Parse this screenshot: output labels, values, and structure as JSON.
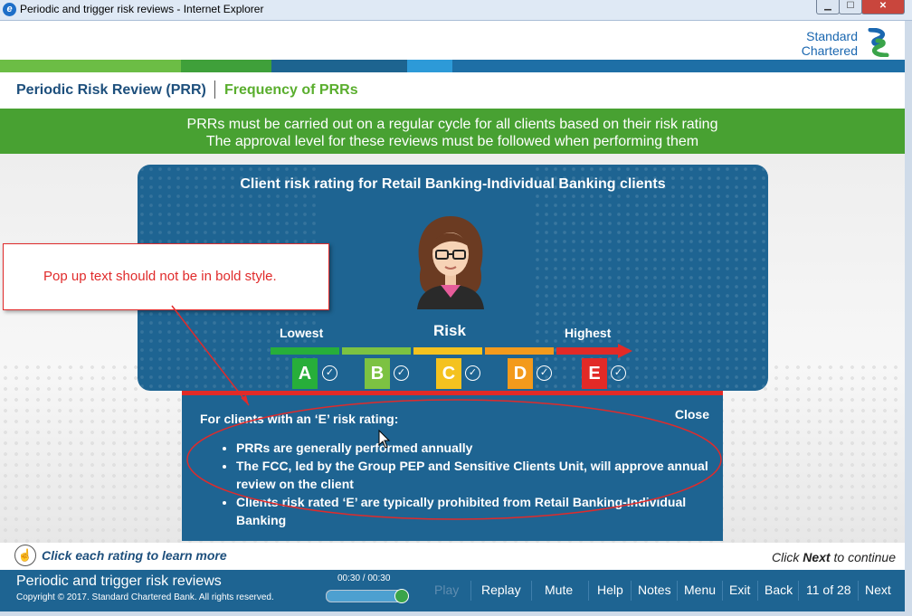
{
  "window": {
    "title": "Periodic and trigger risk reviews - Internet Explorer",
    "minimize": "▁",
    "maximize": "☐",
    "close": "✕"
  },
  "logo": {
    "line1": "Standard",
    "line2": "Chartered"
  },
  "colors": {
    "blue": "#1e6492",
    "green": "#48a132",
    "red": "#e22a27",
    "accent_green": "#5aae2e"
  },
  "breadcrumb": {
    "main": "Periodic Risk Review (PRR)",
    "sub": "Frequency of PRRs"
  },
  "banner": {
    "line1": "PRRs must be carried out on a regular cycle for all clients based on their risk rating",
    "line2": "The approval level for these reviews must be followed when performing them"
  },
  "card": {
    "title": "Client risk rating for Retail Banking-Individual Banking clients",
    "lowest": "Lowest",
    "risk": "Risk",
    "highest": "Highest",
    "ratings": [
      {
        "letter": "A",
        "color": "#27ae3a"
      },
      {
        "letter": "B",
        "color": "#7cc242"
      },
      {
        "letter": "C",
        "color": "#f4c21f"
      },
      {
        "letter": "D",
        "color": "#f39a1c"
      },
      {
        "letter": "E",
        "color": "#e22a27"
      }
    ],
    "check": "✓"
  },
  "popup": {
    "heading": "For clients with an ‘E’ risk rating:",
    "close": "Close",
    "bullets": [
      "PRRs are generally performed annually",
      "The FCC, led by the Group PEP and Sensitive Clients Unit, will approve annual review on the client",
      "Clients risk rated ‘E’ are typically prohibited from Retail Banking-Individual Banking"
    ]
  },
  "annotation": {
    "text": "Pop up text should not be in bold style."
  },
  "hint": {
    "icon": "☝",
    "text": "Click each rating to learn more"
  },
  "next_hint": {
    "pre": "Click ",
    "bold": "Next",
    "post": " to continue"
  },
  "footer": {
    "title": "Periodic and trigger risk reviews",
    "copyright": "Copyright © 2017. Standard Chartered Bank. All rights reserved.",
    "timer": "00:30 / 00:30",
    "progress": 1.0,
    "buttons": {
      "play": "Play",
      "replay": "Replay",
      "mute": "Mute",
      "help": "Help",
      "notes": "Notes",
      "menu": "Menu",
      "exit": "Exit",
      "back": "Back",
      "page": "11 of 28",
      "next": "Next"
    }
  }
}
